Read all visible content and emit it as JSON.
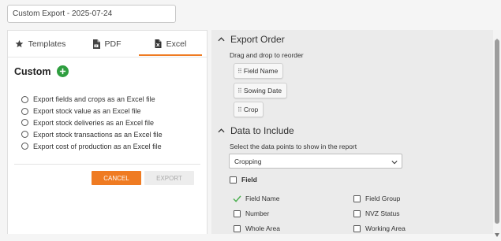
{
  "export_title": "Custom Export - 2025-07-24",
  "tabs": [
    {
      "label": "Templates",
      "icon": "star-icon"
    },
    {
      "label": "PDF",
      "icon": "pdf-file-icon"
    },
    {
      "label": "Excel",
      "icon": "excel-file-icon",
      "active": true
    }
  ],
  "custom": {
    "title": "Custom",
    "options": [
      "Export fields and crops as an Excel file",
      "Export stock value as an Excel file",
      "Export stock deliveries as an Excel file",
      "Export stock transactions as an Excel file",
      "Export cost of production as an Excel file"
    ],
    "cancel_label": "CANCEL",
    "export_label": "EXPORT"
  },
  "export_order": {
    "title": "Export Order",
    "subtitle": "Drag and drop to reorder",
    "items": [
      "Field Name",
      "Sowing Date",
      "Crop"
    ]
  },
  "data_to_include": {
    "title": "Data to Include",
    "subtitle": "Select the data points to show in the report",
    "selected_category": "Cropping",
    "group_label": "Field",
    "checkboxes": [
      {
        "label": "Field Name",
        "checked": true
      },
      {
        "label": "Field Group",
        "checked": false
      },
      {
        "label": "Number",
        "checked": false
      },
      {
        "label": "NVZ Status",
        "checked": false
      },
      {
        "label": "Whole Area",
        "checked": false
      },
      {
        "label": "Working Area",
        "checked": false
      }
    ]
  },
  "colors": {
    "accent": "#ef7b22",
    "add_green": "#2e9e3f",
    "check_green": "#4caf50"
  }
}
